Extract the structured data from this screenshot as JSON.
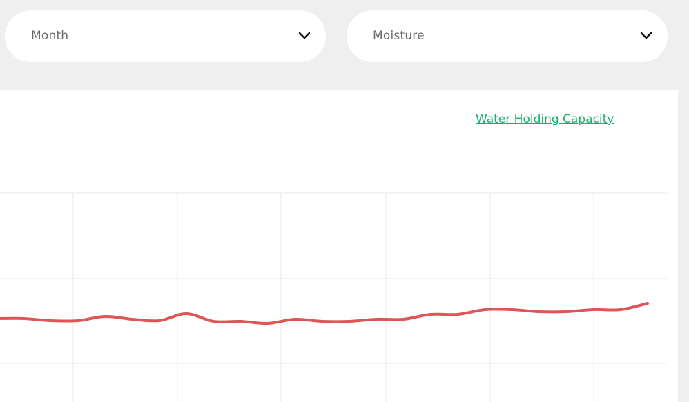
{
  "filters": {
    "period_select": {
      "value": "Month",
      "icon": "chevron-down-icon"
    },
    "metric_select": {
      "value": "Moisture",
      "icon": "chevron-down-icon"
    }
  },
  "chart_data": {
    "type": "line",
    "legend": "Water Holding Capacity",
    "grid": true,
    "series": [
      {
        "name": "Water Holding Capacity",
        "color": "#de5555",
        "values": [
          462,
          462,
          465,
          465,
          459,
          463,
          465,
          455,
          466,
          466,
          469,
          463,
          466,
          466,
          463,
          463,
          456,
          456,
          449,
          449,
          452,
          452,
          449,
          449,
          440
        ]
      }
    ]
  }
}
